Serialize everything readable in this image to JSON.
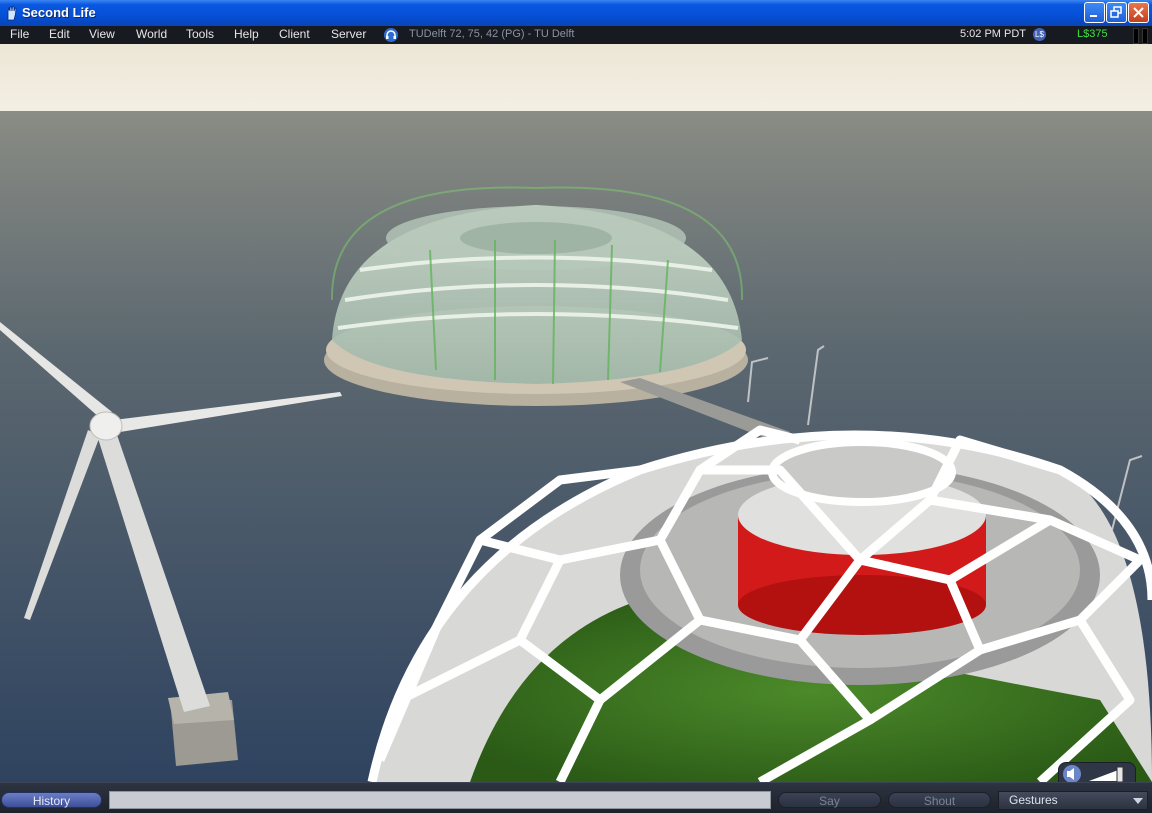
{
  "window": {
    "title": "Second Life"
  },
  "menu": {
    "items": [
      "File",
      "Edit",
      "View",
      "World",
      "Tools",
      "Help",
      "Client",
      "Server"
    ],
    "location": "TUDelft 72, 75, 42 (PG) - TU Delft",
    "clock": "5:02 PM PDT",
    "ls_icon_label": "L$",
    "balance": "L$375"
  },
  "chat": {
    "history_label": "History",
    "input_value": "",
    "say_label": "Say",
    "shout_label": "Shout",
    "gestures_value": "Gestures"
  },
  "icons": {
    "app": "second-life-hand-icon",
    "voice": "voice-headset-icon",
    "minimize": "minimize-icon",
    "maximize": "maximize-icon",
    "close": "close-icon",
    "volume": "volume-speaker-icon"
  },
  "colors": {
    "titlebar_blue": "#0550d6",
    "menubar_bg": "#171b21",
    "balance_green": "#3fe03f",
    "sea": "#3a4e68",
    "sky_top": "#ece6d6"
  }
}
